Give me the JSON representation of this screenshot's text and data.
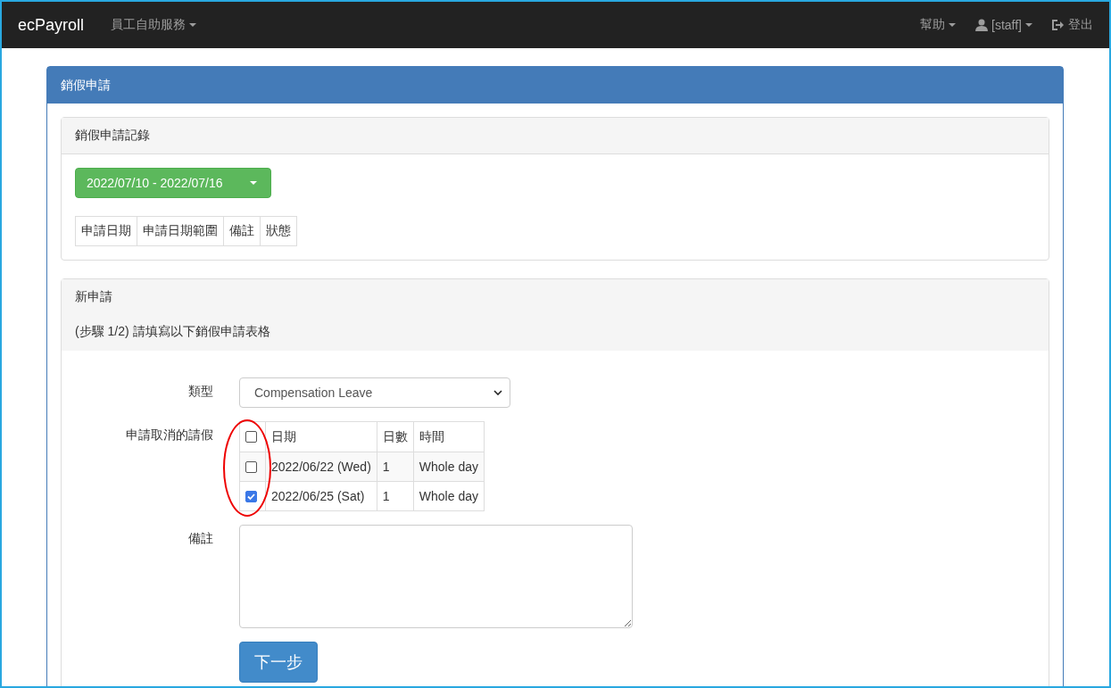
{
  "navbar": {
    "brand": "ecPayroll",
    "menus": [
      {
        "label": "員工自助服務",
        "kind": "dropdown"
      }
    ],
    "right_menus": [
      {
        "label": "幫助",
        "kind": "dropdown"
      },
      {
        "label": "[staff]",
        "kind": "user"
      },
      {
        "label": "登出",
        "kind": "logout"
      }
    ]
  },
  "panel": {
    "title": "銷假申請",
    "history": {
      "title": "銷假申請記錄",
      "date_range": "2022/07/10 - 2022/07/16",
      "columns": [
        "申請日期",
        "申請日期範圍",
        "備註",
        "狀態"
      ]
    },
    "new_request": {
      "title": "新申請",
      "step": "(步驟 1/2) 請填寫以下銷假申請表格",
      "type_label": "類型",
      "type_value": "Compensation Leave",
      "leave_label": "申請取消的請假",
      "leave_table": {
        "header_checked": false,
        "columns": [
          "日期",
          "日數",
          "時間"
        ],
        "rows": [
          {
            "date": "2022/06/22 (Wed)",
            "days": "1",
            "time": "Whole day",
            "checked": false
          },
          {
            "date": "2022/06/25 (Sat)",
            "days": "1",
            "time": "Whole day",
            "checked": true
          }
        ]
      },
      "remark_label": "備註",
      "next_button": "下一步"
    }
  }
}
